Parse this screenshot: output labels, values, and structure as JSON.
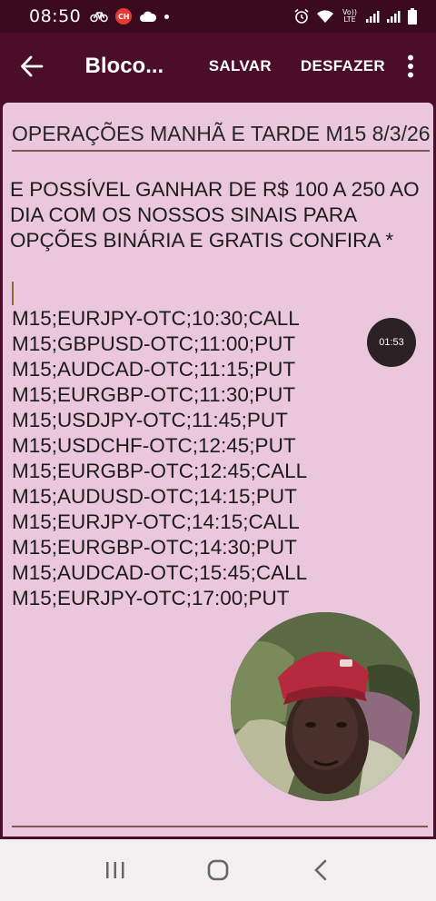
{
  "status_bar": {
    "time": "08:50",
    "icons": [
      "bicycle-icon",
      "screen-record-icon",
      "cloud-icon",
      "dot-icon",
      "alarm-icon",
      "wifi-icon",
      "volte-icon",
      "signal-icon",
      "signal-icon",
      "battery-icon"
    ],
    "rec_badge": "CH",
    "volte_label": "Vo)) LTE"
  },
  "app_bar": {
    "title": "Bloco...",
    "save_label": "SALVAR",
    "undo_label": "DESFAZER"
  },
  "note": {
    "title": "OPERAÇÕES MANHÃ E TARDE M15 8/3/26",
    "body": "E POSSÍVEL GANHAR DE R$ 100 A 250 AO DIA COM OS NOSSOS SINAIS PARA OPÇÕES BINÁRIA E GRATIS CONFIRA *",
    "signals": [
      "M15;EURJPY-OTC;10:30;CALL",
      "M15;GBPUSD-OTC;11:00;PUT",
      "M15;AUDCAD-OTC;11:15;PUT",
      "M15;EURGBP-OTC;11:30;PUT",
      "M15;USDJPY-OTC;11:45;PUT",
      "M15;USDCHF-OTC;12:45;PUT",
      "M15;EURGBP-OTC;12:45;CALL",
      "M15;AUDUSD-OTC;14:15;PUT",
      "M15;EURJPY-OTC;14:15;CALL",
      "M15;EURGBP-OTC;14:30;PUT",
      "M15;AUDCAD-OTC;15:45;CALL",
      "M15;EURJPY-OTC;17:00;PUT"
    ]
  },
  "overlay": {
    "timer": "01:53"
  },
  "colors": {
    "app_bar": "#4a0e28",
    "status_bar": "#3a0a1f",
    "paper": "#ebc7de",
    "rule": "#7a5a55"
  }
}
